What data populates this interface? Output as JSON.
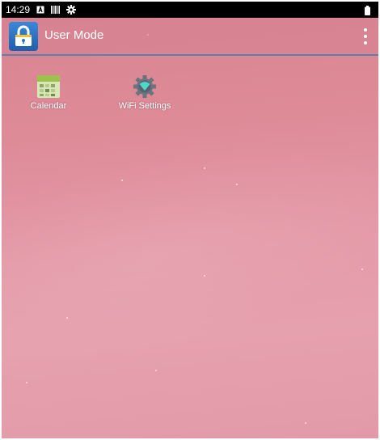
{
  "status_bar": {
    "time": "14:29",
    "icons": [
      "notification-a-icon",
      "barcode-icon",
      "gear-icon"
    ],
    "battery_icon": "battery-icon"
  },
  "action_bar": {
    "title": "User Mode",
    "logo_icon": "lock-icon",
    "menu_icon": "overflow-menu-icon"
  },
  "apps": [
    {
      "label": "Calendar",
      "icon": "calendar-icon"
    },
    {
      "label": "WiFi Settings",
      "icon": "wifi-settings-icon"
    }
  ],
  "colors": {
    "accent_line": "#5a7fb0",
    "logo_blue": "#2b74c8",
    "wallpaper_pink": "#e08f9d",
    "gear_teal": "#4fd8c8",
    "gear_gray": "#6a7480"
  }
}
